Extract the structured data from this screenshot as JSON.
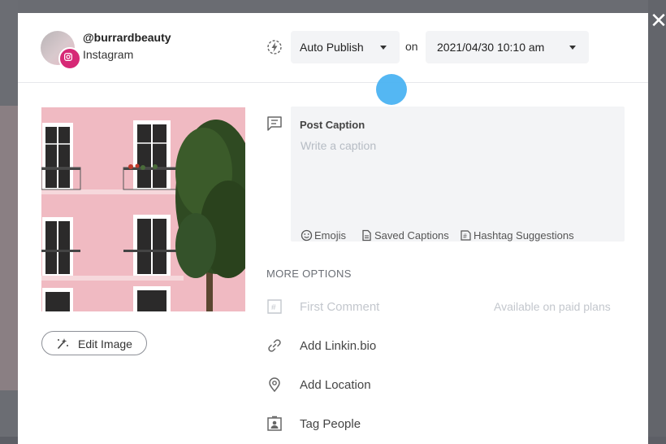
{
  "account": {
    "handle": "@burrardbeauty",
    "platform": "Instagram"
  },
  "header": {
    "publish_mode": "Auto Publish",
    "connector": "on",
    "datetime": "2021/04/30 10:10 am"
  },
  "media": {
    "edit_label": "Edit Image"
  },
  "caption": {
    "title": "Post Caption",
    "placeholder": "Write a caption",
    "value": "",
    "tools": {
      "emojis": "Emojis",
      "saved": "Saved Captions",
      "hashtags": "Hashtag Suggestions"
    }
  },
  "more_options": {
    "title": "MORE OPTIONS",
    "first_comment": "First Comment",
    "paid_note": "Available on paid plans",
    "linkin_bio": "Add Linkin.bio",
    "location": "Add Location",
    "tag_people": "Tag People"
  },
  "icons": {
    "close": "close-icon",
    "instagram": "instagram-icon",
    "publish": "lightning-icon",
    "caption": "message-icon",
    "edit": "magic-wand-icon",
    "emoji": "smiley-icon",
    "saved": "document-icon",
    "hashtag": "hashtag-icon",
    "link": "link-icon",
    "location": "map-pin-icon",
    "tag": "person-tag-icon"
  },
  "colors": {
    "instagram": "#d62976",
    "cursor_highlight": "#4bb3f2"
  }
}
